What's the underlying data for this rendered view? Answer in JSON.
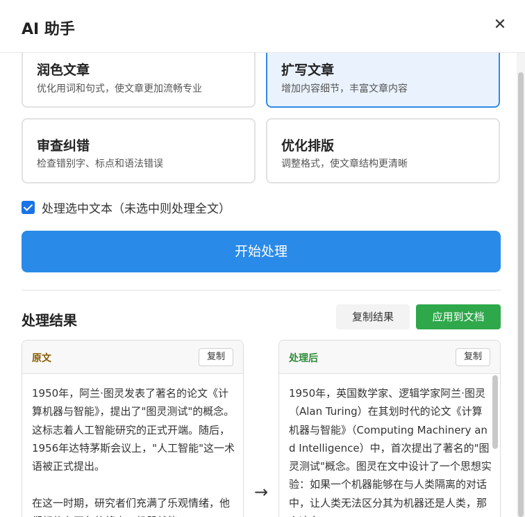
{
  "dialog": {
    "title": "AI 助手",
    "close_icon": "✕"
  },
  "options": [
    {
      "title": "润色文章",
      "desc": "优化用词和句式，使文章更加流畅专业",
      "selected": false
    },
    {
      "title": "扩写文章",
      "desc": "增加内容细节，丰富文章内容",
      "selected": true
    },
    {
      "title": "审查纠错",
      "desc": "检查错别字、标点和语法错误",
      "selected": false
    },
    {
      "title": "优化排版",
      "desc": "调整格式，使文章结构更清晰",
      "selected": false
    }
  ],
  "checkbox": {
    "label": "处理选中文本（未选中则处理全文）",
    "checked": true
  },
  "start_button": "开始处理",
  "results": {
    "title": "处理结果",
    "copy_result": "复制结果",
    "apply": "应用到文档",
    "original": {
      "label": "原文",
      "copy": "复制",
      "text": "1950年，阿兰·图灵发表了著名的论文《计算机器与智能》，提出了\"图灵测试\"的概念。这标志着人工智能研究的正式开端。随后，1956年达特茅斯会议上，\"人工智能\"这一术语被正式提出。\n\n在这一时期，研究者们充满了乐观情绪，他们相信在不久的将来，机器就能"
    },
    "processed": {
      "label": "处理后",
      "copy": "复制",
      "text": "1950年，英国数学家、逻辑学家阿兰·图灵（Alan Turing）在其划时代的论文《计算机器与智能》（Computing Machinery and Intelligence）中，首次提出了著名的\"图灵测试\"概念。图灵在文中设计了一个思想实验：如果一个机器能够在与人类隔离的对话中，让人类无法区分其为机器还是人类，那么这台"
    },
    "arrow_icon": "→"
  }
}
